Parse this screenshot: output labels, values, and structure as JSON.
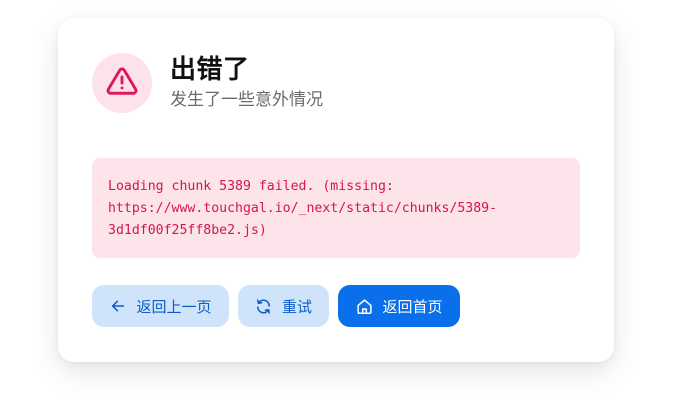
{
  "colors": {
    "accent": "#0a6fea",
    "danger": "#d5164d",
    "danger_bg": "#fde4ea",
    "light_button_bg": "#cfe3fb",
    "light_button_text": "#0b5ec6"
  },
  "header": {
    "icon": "warning-triangle-icon",
    "title": "出错了",
    "subtitle": "发生了一些意外情况"
  },
  "error": {
    "message": "Loading chunk 5389 failed. (missing:\nhttps://www.touchgal.io/_next/static/chunks/5389-\n3d1df00f25ff8be2.js)"
  },
  "actions": {
    "back": {
      "label": "返回上一页",
      "icon": "arrow-left-icon"
    },
    "retry": {
      "label": "重试",
      "icon": "refresh-icon"
    },
    "home": {
      "label": "返回首页",
      "icon": "home-icon"
    }
  }
}
